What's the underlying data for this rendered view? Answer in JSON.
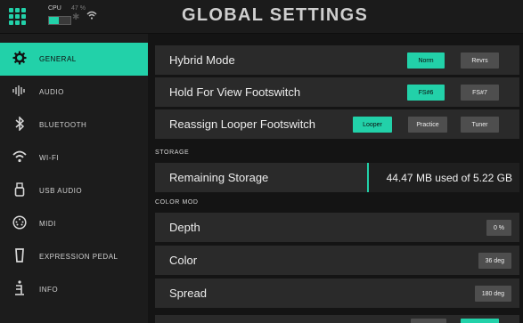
{
  "header": {
    "title": "GLOBAL SETTINGS",
    "cpu_label": "CPU",
    "cpu_percent": "47 %",
    "cpu_level": 0.47
  },
  "sidebar": {
    "items": [
      {
        "label": "GENERAL",
        "icon": "gear-icon"
      },
      {
        "label": "AUDIO",
        "icon": "waveform-icon"
      },
      {
        "label": "BLUETOOTH",
        "icon": "bluetooth-icon"
      },
      {
        "label": "WI-FI",
        "icon": "wifi-icon"
      },
      {
        "label": "USB AUDIO",
        "icon": "usb-icon"
      },
      {
        "label": "MIDI",
        "icon": "midi-icon"
      },
      {
        "label": "EXPRESSION PEDAL",
        "icon": "expression-pedal-icon"
      },
      {
        "label": "INFO",
        "icon": "info-icon"
      }
    ],
    "active": "GENERAL"
  },
  "main": {
    "hybrid_mode": {
      "label": "Hybrid Mode",
      "options": [
        "Norm",
        "Revrs"
      ],
      "selected": "Norm"
    },
    "hold_view": {
      "label": "Hold For View Footswitch",
      "options": [
        "FS#6",
        "FS#7"
      ],
      "selected": "FS#6"
    },
    "reassign_looper": {
      "label": "Reassign Looper Footswitch",
      "options": [
        "Looper",
        "Practice",
        "Tuner"
      ],
      "selected": "Looper"
    },
    "storage_section": "STORAGE",
    "remaining_storage": {
      "label": "Remaining Storage",
      "value": "44.47 MB used of 5.22 GB"
    },
    "color_mod_section": "COLOR MOD",
    "depth": {
      "label": "Depth",
      "value": "0 %"
    },
    "color": {
      "label": "Color",
      "value": "36 deg"
    },
    "spread": {
      "label": "Spread",
      "value": "180 deg"
    }
  },
  "colors": {
    "accent": "#22d1a9",
    "background": "#151515",
    "row": "#2a2a2a"
  }
}
